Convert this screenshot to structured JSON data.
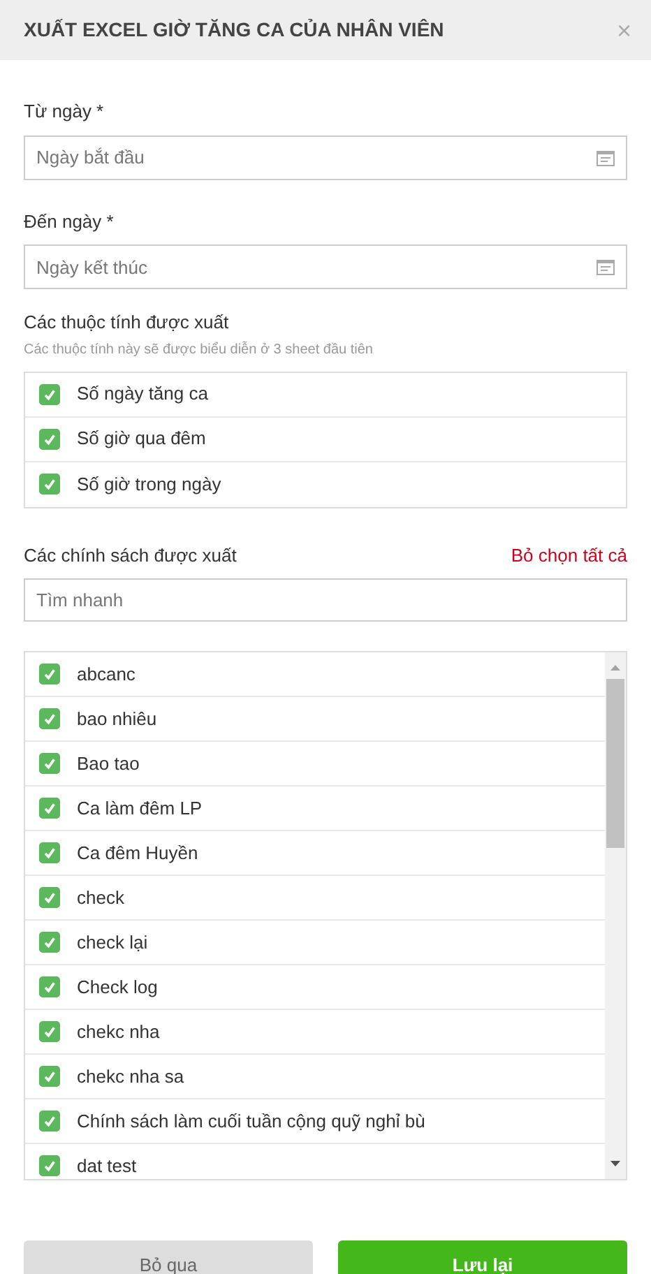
{
  "dialog": {
    "title": "XUẤT EXCEL GIỜ TĂNG CA CỦA NHÂN VIÊN",
    "close": "×"
  },
  "from_date": {
    "label": "Từ ngày *",
    "placeholder": "Ngày bắt đầu"
  },
  "to_date": {
    "label": "Đến ngày *",
    "placeholder": "Ngày kết thúc"
  },
  "attributes": {
    "title": "Các thuộc tính được xuất",
    "hint": "Các thuộc tính này sẽ được biểu diễn ở 3 sheet đầu tiên",
    "items": [
      {
        "label": "Số ngày tăng ca",
        "checked": true
      },
      {
        "label": "Số giờ qua đêm",
        "checked": true
      },
      {
        "label": "Số giờ trong ngày",
        "checked": true
      }
    ]
  },
  "policies": {
    "title": "Các chính sách được xuất",
    "deselect_all": "Bỏ chọn tất cả",
    "search": {
      "placeholder": "Tìm nhanh"
    },
    "items": [
      {
        "label": "abcanc",
        "checked": true
      },
      {
        "label": "bao nhiêu",
        "checked": true
      },
      {
        "label": "Bao tao",
        "checked": true
      },
      {
        "label": "Ca làm đêm LP",
        "checked": true
      },
      {
        "label": "Ca đêm Huyền",
        "checked": true
      },
      {
        "label": "check",
        "checked": true
      },
      {
        "label": "check lại",
        "checked": true
      },
      {
        "label": "Check log",
        "checked": true
      },
      {
        "label": "chekc nha",
        "checked": true
      },
      {
        "label": "chekc nha sa",
        "checked": true
      },
      {
        "label": "Chính sách làm cuối tuần cộng quỹ nghỉ bù",
        "checked": true
      },
      {
        "label": "dat test",
        "checked": true
      }
    ]
  },
  "buttons": {
    "cancel": "Bỏ qua",
    "save": "Lưu lại"
  }
}
